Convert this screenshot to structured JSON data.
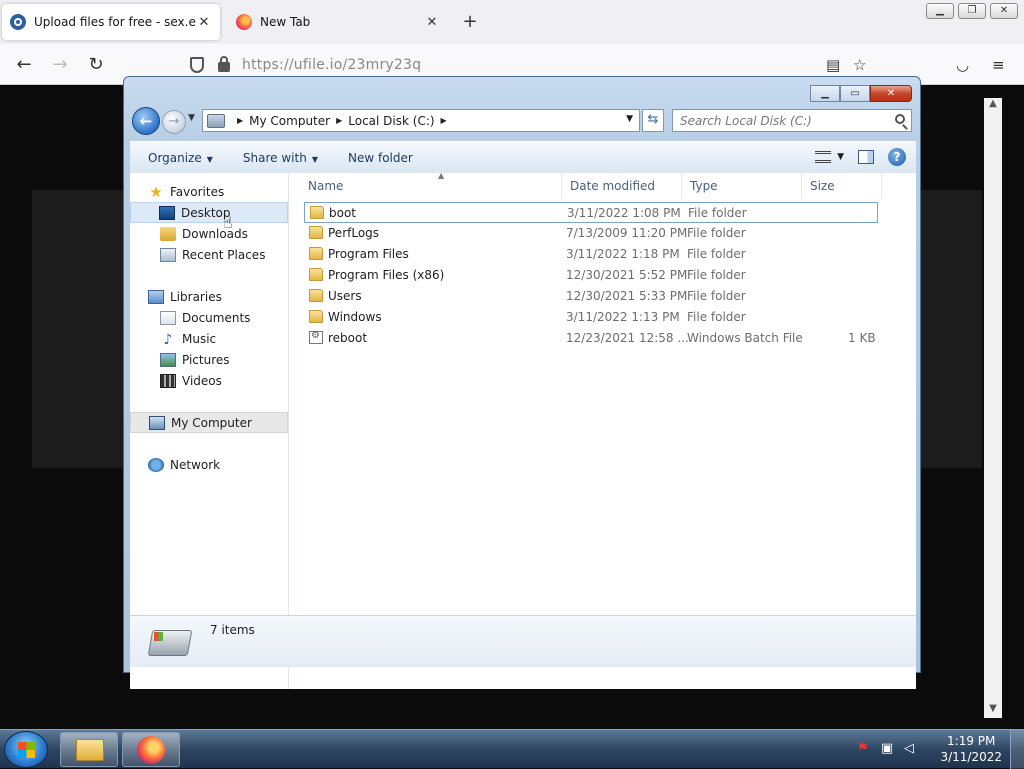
{
  "browser": {
    "tabs": [
      {
        "title": "Upload files for free - sex.exe - u",
        "icon": "ufile-favicon",
        "active": true
      },
      {
        "title": "New Tab",
        "icon": "firefox-favicon",
        "active": false
      }
    ],
    "url": "https://ufile.io/23mry23q"
  },
  "explorer": {
    "breadcrumb": [
      "My Computer",
      "Local Disk (C:)"
    ],
    "search_placeholder": "Search Local Disk (C:)",
    "toolbar": {
      "organize": "Organize",
      "share_with": "Share with",
      "new_folder": "New folder"
    },
    "nav": {
      "favorites": "Favorites",
      "desktop": "Desktop",
      "downloads": "Downloads",
      "recent_places": "Recent Places",
      "libraries": "Libraries",
      "documents": "Documents",
      "music": "Music",
      "pictures": "Pictures",
      "videos": "Videos",
      "my_computer": "My Computer",
      "network": "Network"
    },
    "columns": {
      "name": "Name",
      "date": "Date modified",
      "type": "Type",
      "size": "Size"
    },
    "files": [
      {
        "name": "boot",
        "date": "3/11/2022 1:08 PM",
        "type": "File folder",
        "size": ""
      },
      {
        "name": "PerfLogs",
        "date": "7/13/2009 11:20 PM",
        "type": "File folder",
        "size": ""
      },
      {
        "name": "Program Files",
        "date": "3/11/2022 1:18 PM",
        "type": "File folder",
        "size": ""
      },
      {
        "name": "Program Files (x86)",
        "date": "12/30/2021 5:52 PM",
        "type": "File folder",
        "size": ""
      },
      {
        "name": "Users",
        "date": "12/30/2021 5:33 PM",
        "type": "File folder",
        "size": ""
      },
      {
        "name": "Windows",
        "date": "3/11/2022 1:13 PM",
        "type": "File folder",
        "size": ""
      },
      {
        "name": "reboot",
        "date": "12/23/2021 12:58 ...",
        "type": "Windows Batch File",
        "size": "1 KB"
      }
    ],
    "status": "7 items"
  },
  "taskbar": {
    "time": "1:19 PM",
    "date": "3/11/2022"
  }
}
